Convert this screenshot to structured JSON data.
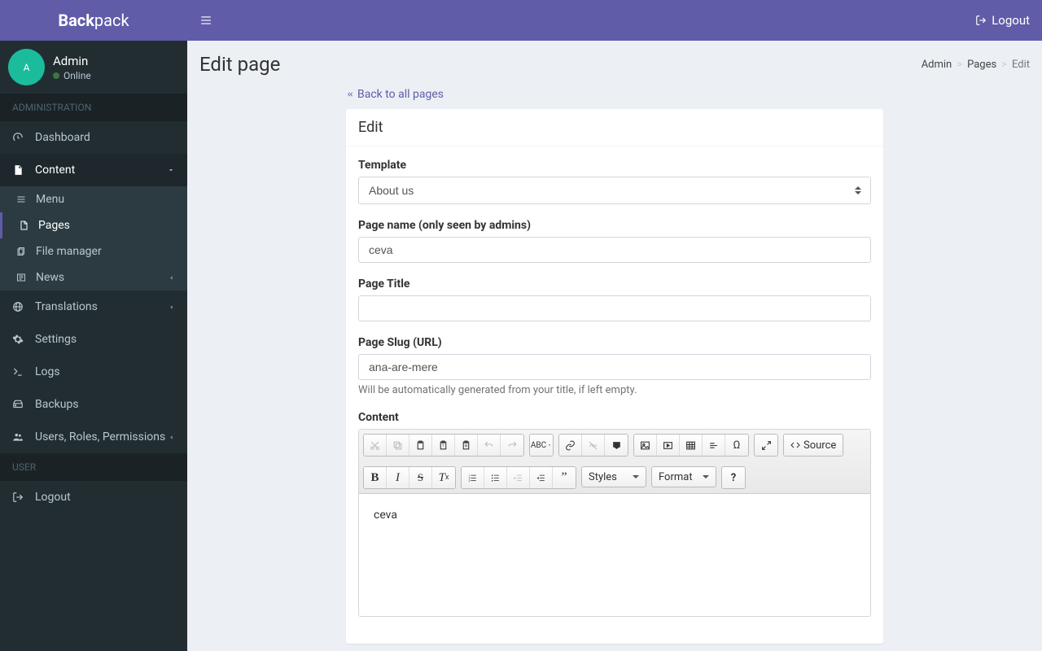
{
  "brand": {
    "bold": "Back",
    "light": "pack"
  },
  "user": {
    "initial": "A",
    "name": "Admin",
    "status": "Online"
  },
  "sidebar": {
    "section_admin": "ADMINISTRATION",
    "section_user": "USER",
    "dashboard": "Dashboard",
    "content": "Content",
    "menu": "Menu",
    "pages": "Pages",
    "file_manager": "File manager",
    "news": "News",
    "translations": "Translations",
    "settings": "Settings",
    "logs": "Logs",
    "backups": "Backups",
    "users_roles": "Users, Roles, Permissions",
    "logout": "Logout"
  },
  "topbar": {
    "logout": "Logout"
  },
  "header": {
    "title": "Edit page"
  },
  "breadcrumb": {
    "admin": "Admin",
    "pages": "Pages",
    "edit": "Edit"
  },
  "back_link": "Back to all pages",
  "box": {
    "title": "Edit"
  },
  "form": {
    "template_label": "Template",
    "template_value": "About us",
    "page_name_label": "Page name (only seen by admins)",
    "page_name_value": "ceva",
    "page_title_label": "Page Title",
    "page_title_value": "",
    "page_slug_label": "Page Slug (URL)",
    "page_slug_value": "ana-are-mere",
    "page_slug_help": "Will be automatically generated from your title, if left empty.",
    "content_label": "Content",
    "content_value": "ceva"
  },
  "editor": {
    "source": "Source",
    "styles": "Styles",
    "format": "Format"
  }
}
